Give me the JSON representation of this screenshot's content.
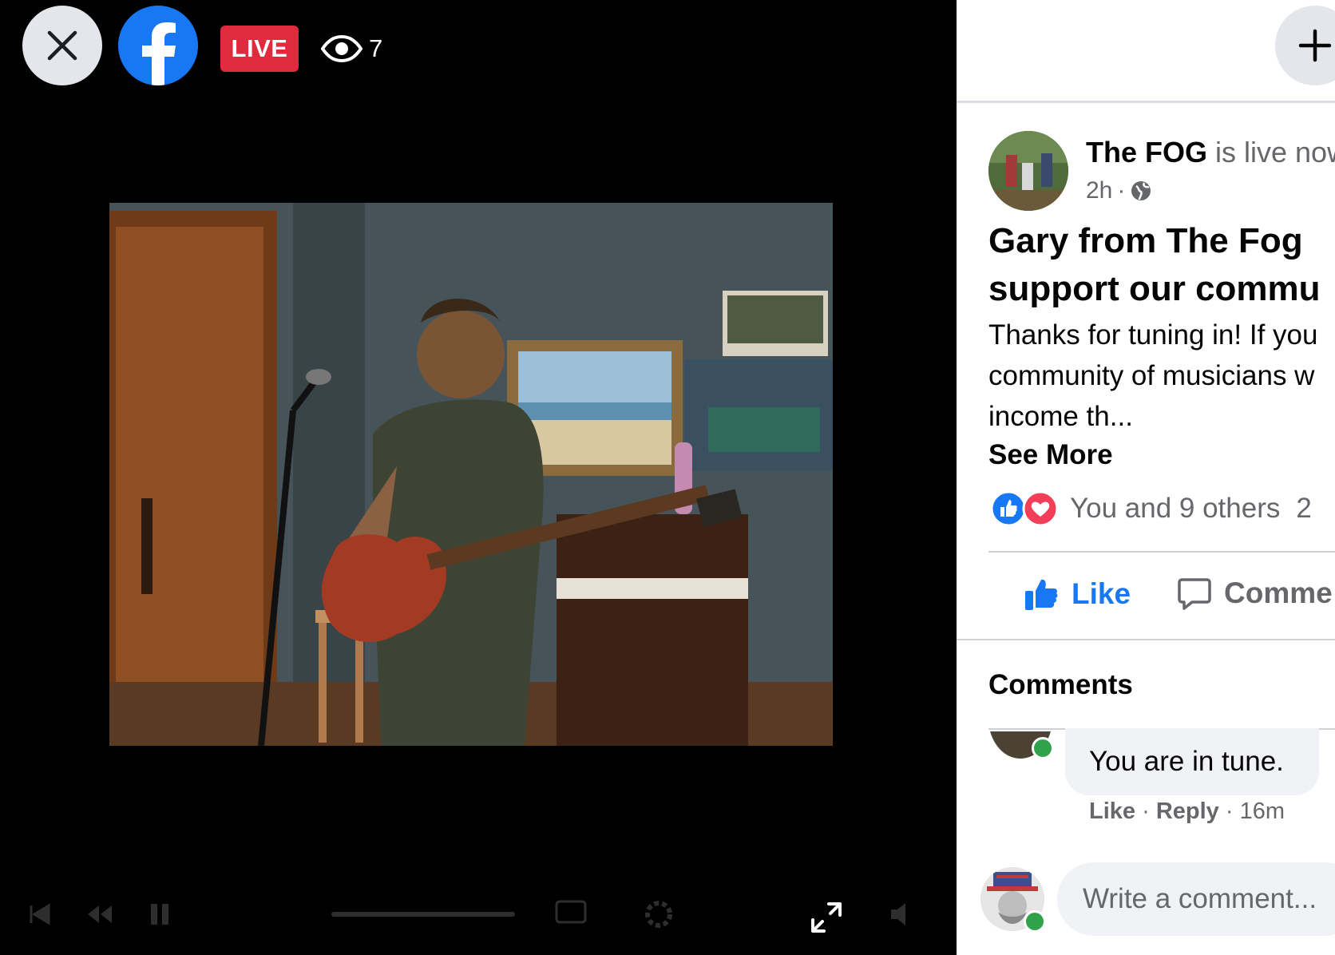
{
  "video": {
    "live_label": "LIVE",
    "viewer_count": "7"
  },
  "post": {
    "page_name": "The FOG",
    "status_text": "is live now",
    "time": "2h",
    "separator": "·",
    "title_line1": "Gary from The Fog",
    "title_line2": "support our commu",
    "body_line1": "Thanks for tuning in! If you",
    "body_line2": "community of musicians w",
    "body_line3": "income th...",
    "see_more": "See More",
    "reactions_text": "You and 9 others",
    "reactions_count_partial": "2",
    "like_label": "Like",
    "comment_label": "Comme"
  },
  "comments": {
    "title": "Comments",
    "items": [
      {
        "text": "You are in tune.",
        "like": "Like",
        "reply": "Reply",
        "time": "16m"
      }
    ],
    "input_placeholder": "Write a comment..."
  },
  "colors": {
    "facebook_blue": "#1877f2",
    "live_red": "#e02a3d",
    "love_red": "#f33e58",
    "online_green": "#31a24c"
  },
  "icons": [
    "close-icon",
    "facebook-logo",
    "eye-icon",
    "fullscreen-icon",
    "plus-icon",
    "globe-icon",
    "like-reaction-icon",
    "love-reaction-icon",
    "thumbs-up-icon",
    "comment-icon"
  ]
}
